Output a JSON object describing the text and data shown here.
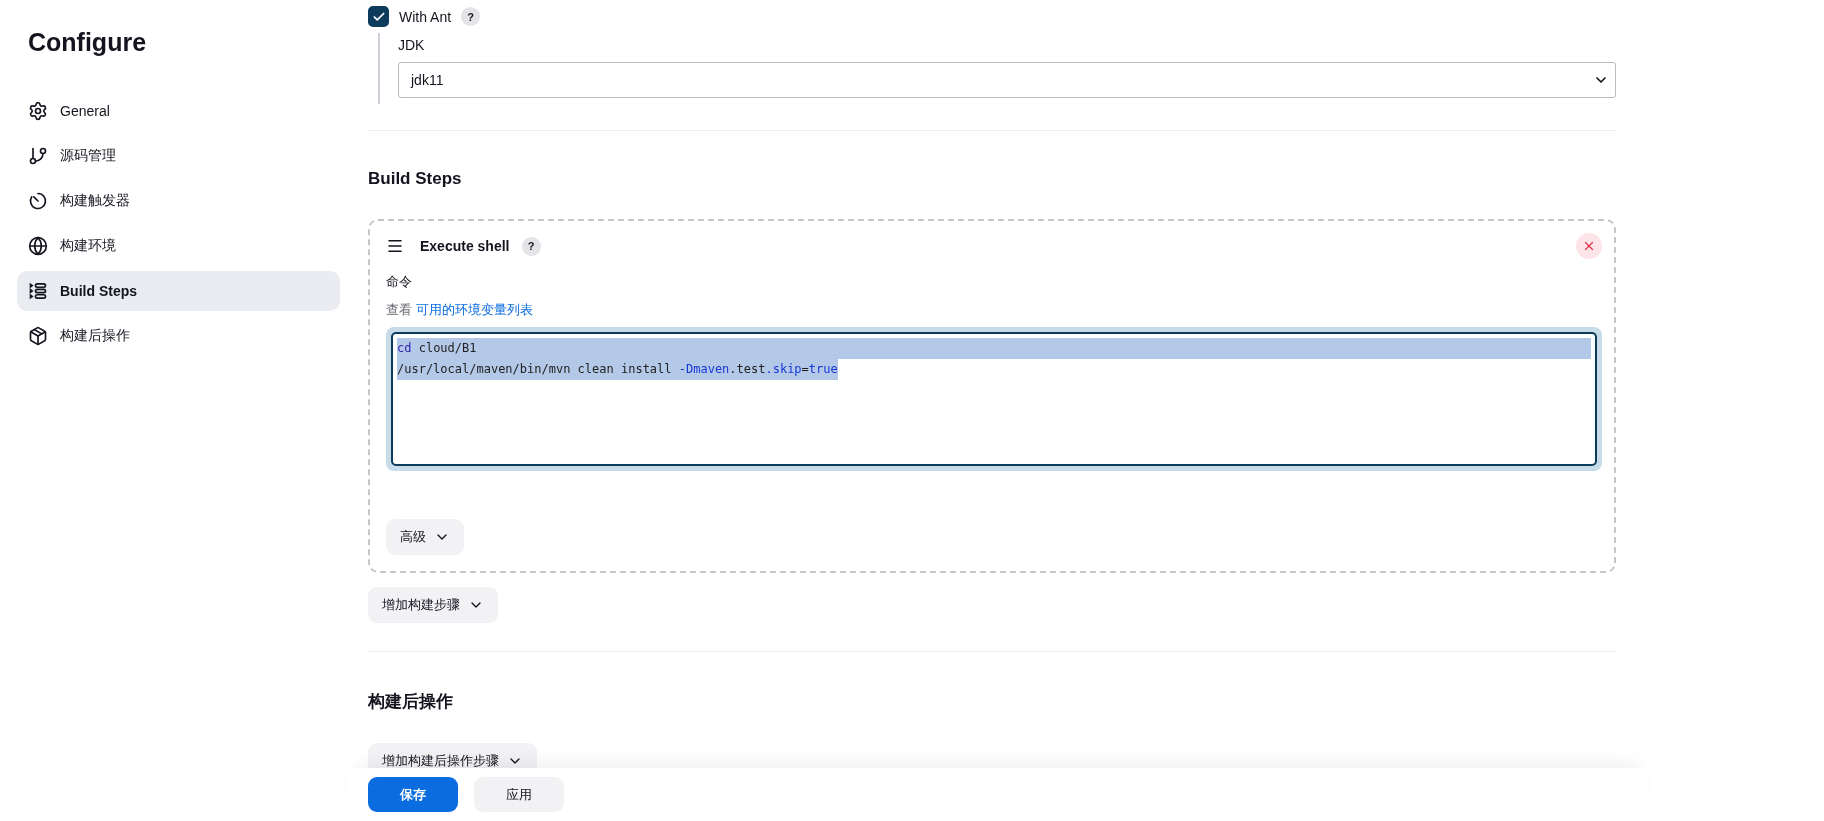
{
  "sidebar": {
    "title": "Configure",
    "items": [
      {
        "label": "General",
        "selected": false
      },
      {
        "label": "源码管理",
        "selected": false
      },
      {
        "label": "构建触发器",
        "selected": false
      },
      {
        "label": "构建环境",
        "selected": false
      },
      {
        "label": "Build Steps",
        "selected": true
      },
      {
        "label": "构建后操作",
        "selected": false
      }
    ]
  },
  "ant": {
    "label": "With Ant",
    "checked": true,
    "help": "?",
    "jdk_label": "JDK",
    "jdk_value": "jdk11"
  },
  "build_steps": {
    "heading": "Build Steps",
    "step": {
      "title": "Execute shell",
      "help": "?",
      "command_label": "命令",
      "view_prefix": "查看",
      "env_link": "可用的环境变量列表",
      "lines": [
        {
          "selected": true,
          "tokens": [
            {
              "text": "cd",
              "kind": "keyword"
            },
            {
              "text": " cloud/B1",
              "kind": "plain"
            }
          ]
        },
        {
          "selected": true,
          "tokens": [
            {
              "text": "/usr/local/maven/bin/mvn clean install ",
              "kind": "plain"
            },
            {
              "text": "-Dmaven",
              "kind": "flag"
            },
            {
              "text": ".test",
              "kind": "plain"
            },
            {
              "text": ".skip",
              "kind": "flag"
            },
            {
              "text": "=",
              "kind": "plain"
            },
            {
              "text": "true",
              "kind": "flag"
            }
          ]
        }
      ],
      "advanced": "高级"
    },
    "add_button": "增加构建步骤"
  },
  "post_build": {
    "heading": "构建后操作",
    "add_button": "增加构建后操作步骤"
  },
  "footer": {
    "save": "保存",
    "apply": "应用"
  }
}
